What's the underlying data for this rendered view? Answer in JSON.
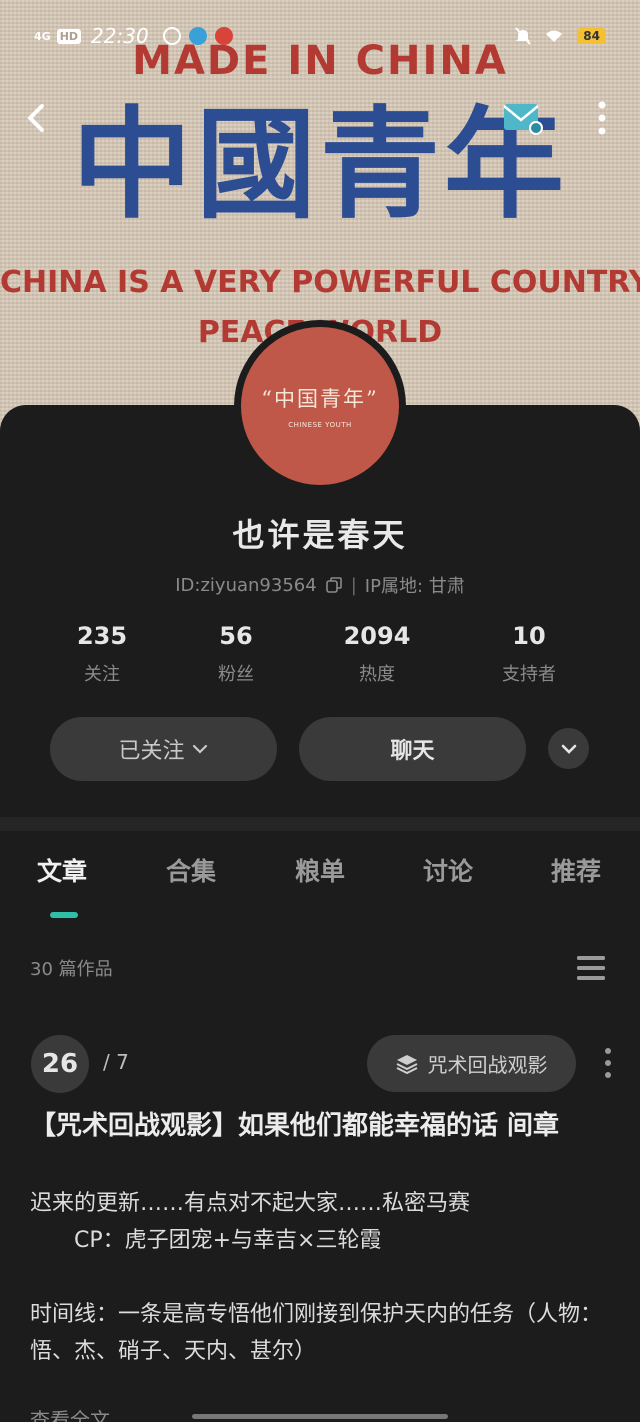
{
  "status_bar": {
    "network": "4G",
    "hd": "HD",
    "time": "22:30",
    "battery": "84"
  },
  "banner": {
    "line1": "MADE IN CHINA",
    "line2": "中國青年",
    "line3": "CHINA IS A VERY POWERFUL COUNTRY",
    "line4": "PEACE WORLD"
  },
  "avatar": {
    "title": "“中国青年”",
    "subtitle": "CHINESE YOUTH"
  },
  "profile": {
    "name": "也许是春天",
    "id": "ID:ziyuan93564",
    "ip": "IP属地: 甘肃"
  },
  "stats": [
    {
      "value": "235",
      "label": "关注"
    },
    {
      "value": "56",
      "label": "粉丝"
    },
    {
      "value": "2094",
      "label": "热度"
    },
    {
      "value": "10",
      "label": "支持者"
    }
  ],
  "buttons": {
    "follow": "已关注",
    "chat": "聊天"
  },
  "tabs": [
    "文章",
    "合集",
    "粮单",
    "讨论",
    "推荐"
  ],
  "works_count": "30 篇作品",
  "post": {
    "index": "26",
    "total": "/ 7",
    "collection": "咒术回战观影",
    "title": "【咒术回战观影】如果他们都能幸福的话 间章",
    "body_line1": "迟来的更新……有点对不起大家……私密马赛",
    "body_line2": "　　CP：虎子团宠+与幸吉×三轮霞",
    "body_line3": "时间线：一条是高专悟他们刚接到保护天内的任务（人物：悟、杰、硝子、天内、甚尔）",
    "read_more": "查看全文"
  },
  "colors": {
    "background": "#1c1c1c",
    "accent": "#2fbfa8",
    "button": "#3a3a3a",
    "avatar": "#c0584a"
  }
}
